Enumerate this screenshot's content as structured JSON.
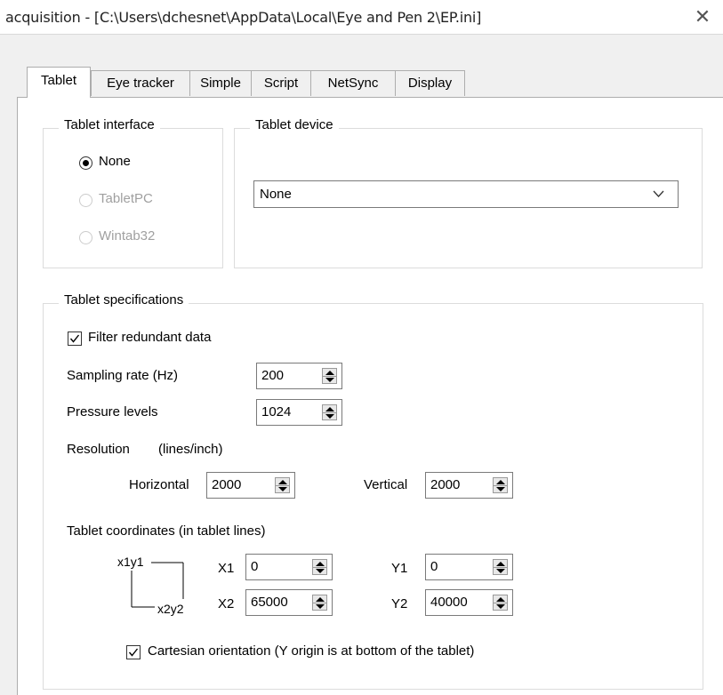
{
  "window": {
    "title": "acquisition - [C:\\Users\\dchesnet\\AppData\\Local\\Eye and Pen 2\\EP.ini]",
    "close_glyph": "✕"
  },
  "tabs": [
    {
      "label": "Tablet",
      "active": true
    },
    {
      "label": "Eye tracker",
      "active": false
    },
    {
      "label": "Simple",
      "active": false
    },
    {
      "label": "Script",
      "active": false
    },
    {
      "label": "NetSync",
      "active": false
    },
    {
      "label": "Display",
      "active": false
    }
  ],
  "tablet_interface": {
    "legend": "Tablet interface",
    "options": [
      {
        "label": "None",
        "selected": true,
        "enabled": true
      },
      {
        "label": "TabletPC",
        "selected": false,
        "enabled": false
      },
      {
        "label": "Wintab32",
        "selected": false,
        "enabled": false
      }
    ]
  },
  "tablet_device": {
    "legend": "Tablet device",
    "selected": "None",
    "dropdown_icon": "chevron-down-icon"
  },
  "specs": {
    "legend": "Tablet specifications",
    "filter_redundant": {
      "label": "Filter redundant data",
      "checked": true
    },
    "sampling_rate": {
      "label": "Sampling rate (Hz)",
      "value": "200"
    },
    "pressure_levels": {
      "label": "Pressure levels",
      "value": "1024"
    },
    "resolution": {
      "label": "Resolution",
      "unit": "(lines/inch)",
      "horizontal_label": "Horizontal",
      "horizontal_value": "2000",
      "vertical_label": "Vertical",
      "vertical_value": "2000"
    },
    "coordinates": {
      "label": "Tablet coordinates (in tablet lines)",
      "diagram_top_left": "x1y1",
      "diagram_bottom_right": "x2y2",
      "x1_label": "X1",
      "x1_value": "0",
      "y1_label": "Y1",
      "y1_value": "0",
      "x2_label": "X2",
      "x2_value": "65000",
      "y2_label": "Y2",
      "y2_value": "40000"
    },
    "cartesian": {
      "label": "Cartesian orientation (Y origin is at bottom of the tablet)",
      "checked": true
    }
  }
}
